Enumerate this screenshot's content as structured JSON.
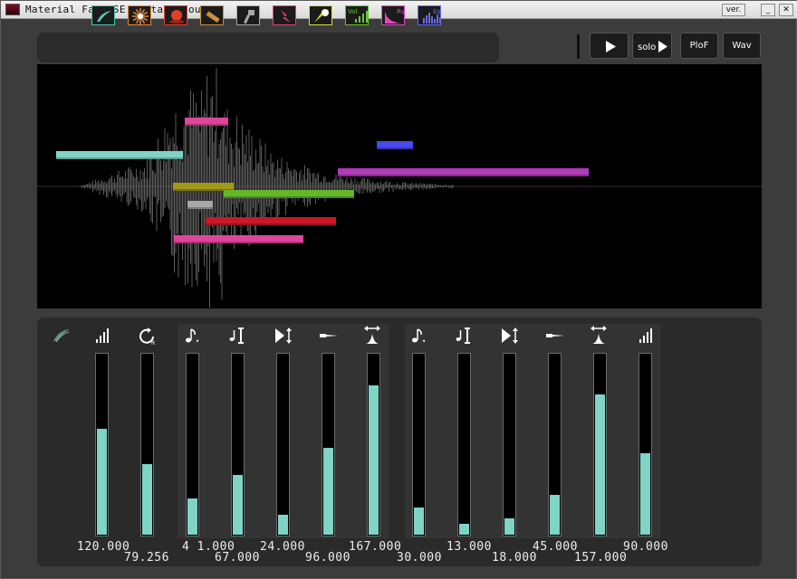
{
  "window": {
    "title": "Material Fact SE -Attack sound-",
    "ver_label": "ver.",
    "minimize_label": "_",
    "close_label": "✕"
  },
  "toolbar": {
    "tools": [
      {
        "name": "swoosh-tool",
        "color": "#4fc7b8"
      },
      {
        "name": "burst-tool",
        "color": "#e88a3a"
      },
      {
        "name": "orb-tool",
        "color": "#e0402a"
      },
      {
        "name": "blade-tool",
        "color": "#c8903e"
      },
      {
        "name": "hammer-tool",
        "color": "#a8a8a8"
      },
      {
        "name": "lightning-tool",
        "color": "#e0457a"
      },
      {
        "name": "comet-tool",
        "color": "#d8e03a"
      },
      {
        "name": "volume-tool",
        "color": "#64c832",
        "label": "Vol"
      },
      {
        "name": "reverb-tool",
        "color": "#e04abe",
        "label": "Rv"
      },
      {
        "name": "equalizer-tool",
        "color": "#6a6ae8",
        "label": "Eq"
      }
    ],
    "play_label": "",
    "solo_label": "solo",
    "plof_label": "PloF",
    "wav_label": "Wav"
  },
  "layers": [
    {
      "name": "teal-layer",
      "color": "#7fd4c6"
    },
    {
      "name": "pink-layer",
      "color": "#e0459a"
    },
    {
      "name": "blue-layer",
      "color": "#4a4ae8"
    },
    {
      "name": "purple-layer",
      "color": "#b03ab8"
    },
    {
      "name": "olive-layer",
      "color": "#a09a18"
    },
    {
      "name": "green-layer",
      "color": "#64b828"
    },
    {
      "name": "gray-layer",
      "color": "#a8a8a8"
    },
    {
      "name": "red-layer",
      "color": "#c8182a"
    },
    {
      "name": "magenta-layer",
      "color": "#e0459a"
    }
  ],
  "params": {
    "sliders": [
      {
        "icon": "volume-icon",
        "level": 0.59,
        "value": "120.000"
      },
      {
        "icon": "loop-icon",
        "level": 0.39,
        "value": "79.256"
      },
      {
        "icon": "pitch-envelope-icon",
        "level": 0.2,
        "value": "1.000",
        "prefix": "4"
      },
      {
        "icon": "pitch-range-icon",
        "level": 0.33,
        "value": "67.000"
      },
      {
        "icon": "attack-icon",
        "level": 0.11,
        "value": "24.000"
      },
      {
        "icon": "release-icon",
        "level": 0.48,
        "value": "96.000"
      },
      {
        "icon": "spread-icon",
        "level": 0.83,
        "value": "167.000"
      },
      {
        "icon": "pitch-envelope-icon",
        "level": 0.15,
        "value": "30.000"
      },
      {
        "icon": "pitch-range-icon",
        "level": 0.06,
        "value": "13.000"
      },
      {
        "icon": "attack-icon",
        "level": 0.09,
        "value": "18.000"
      },
      {
        "icon": "release-icon",
        "level": 0.22,
        "value": "45.000"
      },
      {
        "icon": "spread-icon",
        "level": 0.78,
        "value": "157.000"
      },
      {
        "icon": "volume-icon",
        "level": 0.45,
        "value": "90.000"
      }
    ]
  },
  "colors": {
    "accent": "#7fd4c6",
    "background": "#3c3c3c",
    "panel": "#2a2a2a"
  }
}
